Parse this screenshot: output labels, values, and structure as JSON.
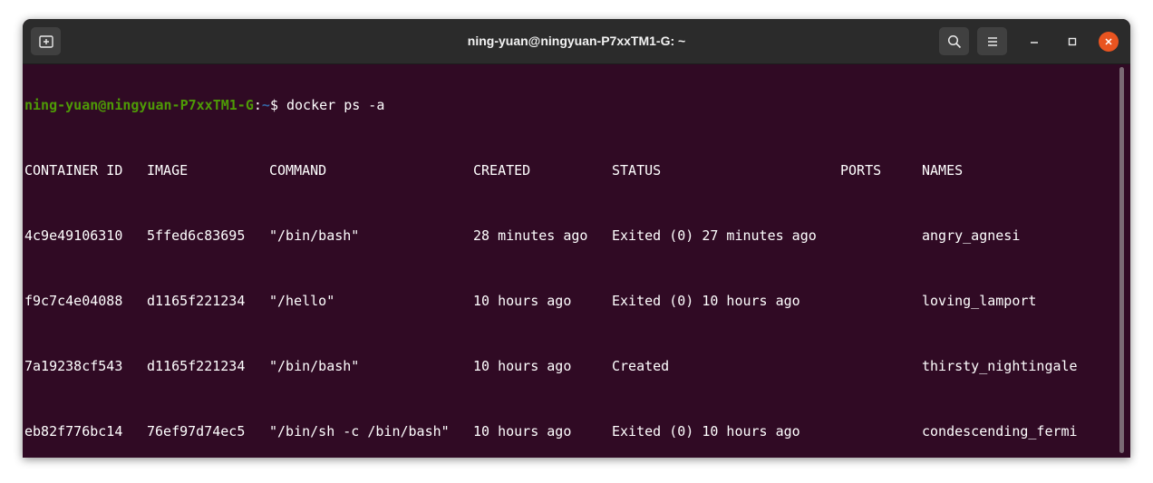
{
  "window": {
    "title": "ning-yuan@ningyuan-P7xxTM1-G: ~"
  },
  "titlebar": {
    "new_tab_icon": "new-tab-icon",
    "search_icon": "search-icon",
    "menu_icon": "hamburger-menu-icon",
    "minimize_icon": "minimize-icon",
    "maximize_icon": "maximize-icon",
    "close_icon": "close-icon"
  },
  "prompt": {
    "user_host": "ning-yuan@ningyuan-P7xxTM1-G",
    "separator": ":",
    "path": "~",
    "symbol": "$ "
  },
  "command": "docker ps -a",
  "table": {
    "headers": [
      "CONTAINER ID",
      "IMAGE",
      "COMMAND",
      "CREATED",
      "STATUS",
      "PORTS",
      "NAMES"
    ],
    "rows": [
      [
        "4c9e49106310",
        "5ffed6c83695",
        "\"/bin/bash\"",
        "28 minutes ago",
        "Exited (0) 27 minutes ago",
        "",
        "angry_agnesi"
      ],
      [
        "f9c7c4e04088",
        "d1165f221234",
        "\"/hello\"",
        "10 hours ago",
        "Exited (0) 10 hours ago",
        "",
        "loving_lamport"
      ],
      [
        "7a19238cf543",
        "d1165f221234",
        "\"/bin/bash\"",
        "10 hours ago",
        "Created",
        "",
        "thirsty_nightingale"
      ],
      [
        "eb82f776bc14",
        "76ef97d74ec5",
        "\"/bin/sh -c /bin/bash\"",
        "10 hours ago",
        "Exited (0) 10 hours ago",
        "",
        "condescending_fermi"
      ]
    ]
  },
  "colors": {
    "terminal_bg": "#300a24",
    "titlebar_bg": "#2b2b2b",
    "prompt_user": "#4e9a06",
    "prompt_path": "#3465a4",
    "close_button": "#e95420"
  }
}
